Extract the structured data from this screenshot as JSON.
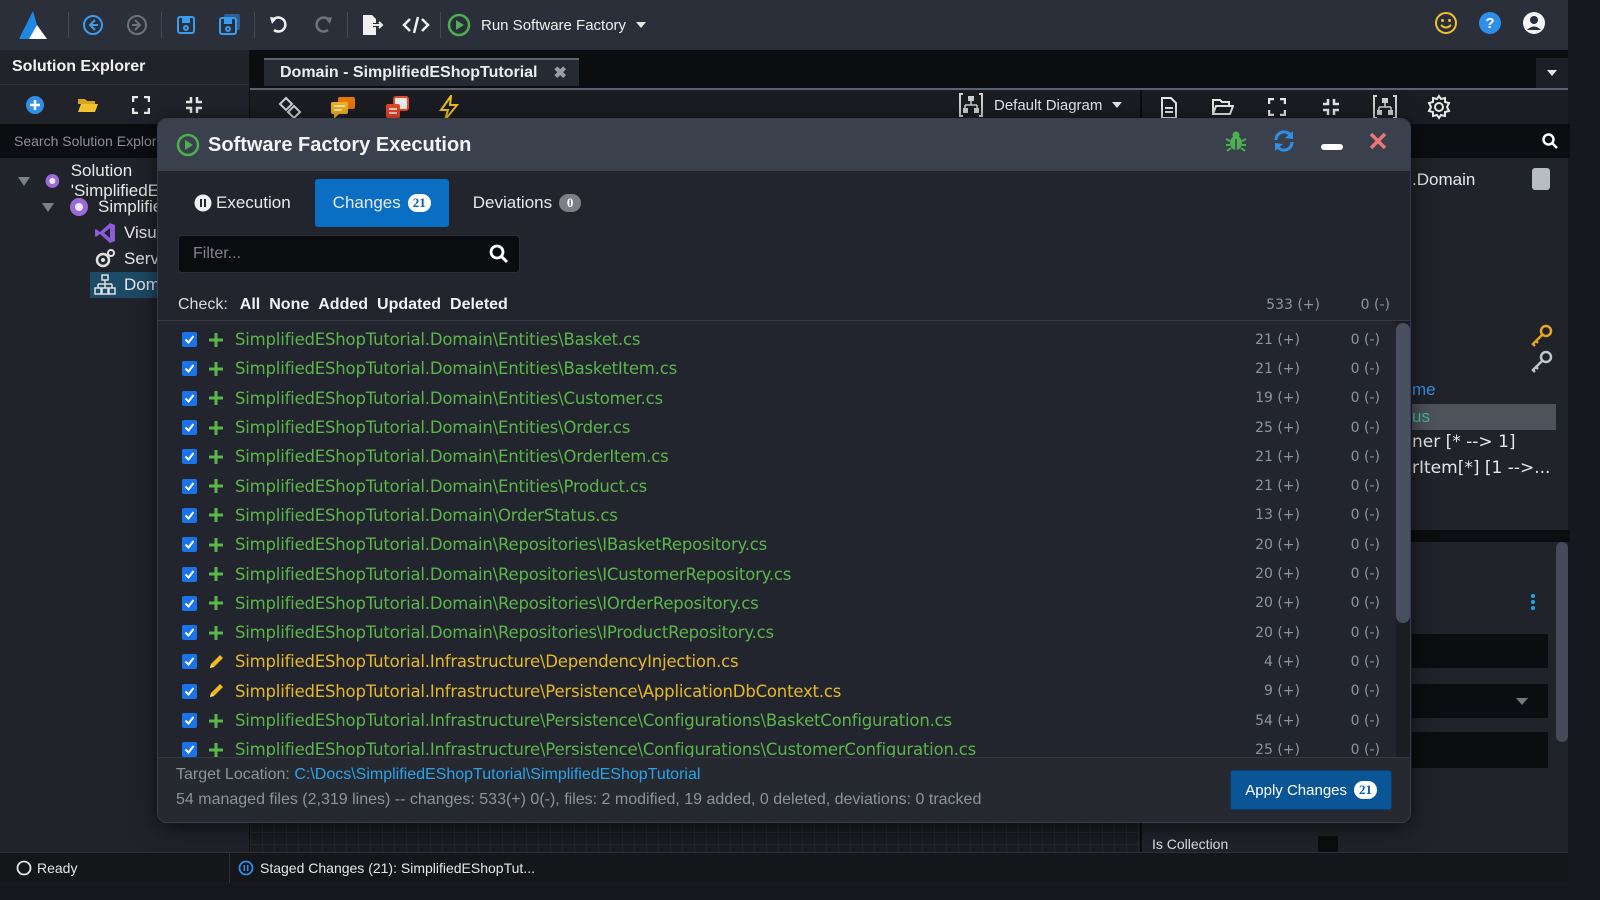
{
  "toolbar": {
    "run_label": "Run Software Factory",
    "icons": [
      "logo-icon",
      "back-icon",
      "forward-icon",
      "save-icon",
      "save-all-icon",
      "undo-icon",
      "redo-icon",
      "export-icon",
      "code-icon",
      "run-icon"
    ],
    "right_icons": [
      "feedback-smiley-icon",
      "help-icon",
      "account-icon"
    ]
  },
  "solution_explorer": {
    "title": "Solution Explorer",
    "search_placeholder": "Search Solution Explorer",
    "tree": [
      {
        "label": "Solution 'SimplifiedEShopTutorial'",
        "icon": "solution-icon"
      },
      {
        "label": "SimplifiedEShopTutorial",
        "icon": "application-icon"
      },
      {
        "label": "Visual Studio",
        "icon": "visual-studio-icon"
      },
      {
        "label": "Services",
        "icon": "services-icon"
      },
      {
        "label": "Domain",
        "icon": "domain-icon"
      }
    ]
  },
  "editor": {
    "tab_title": "Domain - SimplifiedEShopTutorial",
    "diagram_selector": "Default Diagram"
  },
  "right_panel": {
    "header": ".Domain",
    "items": [
      "me",
      "us",
      "ner [* --> 1]",
      "rItem[*] [1 -->..."
    ],
    "property_label": "Is Collection"
  },
  "modal": {
    "title": "Software Factory Execution",
    "tabs": [
      {
        "label": "Execution",
        "badge": null
      },
      {
        "label": "Changes",
        "badge": "21"
      },
      {
        "label": "Deviations",
        "badge": "0"
      }
    ],
    "filter_placeholder": "Filter...",
    "check": {
      "label": "Check:",
      "options": [
        "All",
        "None",
        "Added",
        "Updated",
        "Deleted"
      ],
      "total_added": "533 (+)",
      "total_deleted": "0 (-)"
    },
    "files": [
      {
        "path": "SimplifiedEShopTutorial.Domain\\Entities\\Basket.cs",
        "status": "added",
        "added": "21 (+)",
        "deleted": "0 (-)",
        "checked": true
      },
      {
        "path": "SimplifiedEShopTutorial.Domain\\Entities\\BasketItem.cs",
        "status": "added",
        "added": "21 (+)",
        "deleted": "0 (-)",
        "checked": true
      },
      {
        "path": "SimplifiedEShopTutorial.Domain\\Entities\\Customer.cs",
        "status": "added",
        "added": "19 (+)",
        "deleted": "0 (-)",
        "checked": true
      },
      {
        "path": "SimplifiedEShopTutorial.Domain\\Entities\\Order.cs",
        "status": "added",
        "added": "25 (+)",
        "deleted": "0 (-)",
        "checked": true
      },
      {
        "path": "SimplifiedEShopTutorial.Domain\\Entities\\OrderItem.cs",
        "status": "added",
        "added": "21 (+)",
        "deleted": "0 (-)",
        "checked": true
      },
      {
        "path": "SimplifiedEShopTutorial.Domain\\Entities\\Product.cs",
        "status": "added",
        "added": "21 (+)",
        "deleted": "0 (-)",
        "checked": true
      },
      {
        "path": "SimplifiedEShopTutorial.Domain\\OrderStatus.cs",
        "status": "added",
        "added": "13 (+)",
        "deleted": "0 (-)",
        "checked": true
      },
      {
        "path": "SimplifiedEShopTutorial.Domain\\Repositories\\IBasketRepository.cs",
        "status": "added",
        "added": "20 (+)",
        "deleted": "0 (-)",
        "checked": true
      },
      {
        "path": "SimplifiedEShopTutorial.Domain\\Repositories\\ICustomerRepository.cs",
        "status": "added",
        "added": "20 (+)",
        "deleted": "0 (-)",
        "checked": true
      },
      {
        "path": "SimplifiedEShopTutorial.Domain\\Repositories\\IOrderRepository.cs",
        "status": "added",
        "added": "20 (+)",
        "deleted": "0 (-)",
        "checked": true
      },
      {
        "path": "SimplifiedEShopTutorial.Domain\\Repositories\\IProductRepository.cs",
        "status": "added",
        "added": "20 (+)",
        "deleted": "0 (-)",
        "checked": true
      },
      {
        "path": "SimplifiedEShopTutorial.Infrastructure\\DependencyInjection.cs",
        "status": "modified",
        "added": "4 (+)",
        "deleted": "0 (-)",
        "checked": true
      },
      {
        "path": "SimplifiedEShopTutorial.Infrastructure\\Persistence\\ApplicationDbContext.cs",
        "status": "modified",
        "added": "9 (+)",
        "deleted": "0 (-)",
        "checked": true
      },
      {
        "path": "SimplifiedEShopTutorial.Infrastructure\\Persistence\\Configurations\\BasketConfiguration.cs",
        "status": "added",
        "added": "54 (+)",
        "deleted": "0 (-)",
        "checked": true
      },
      {
        "path": "SimplifiedEShopTutorial.Infrastructure\\Persistence\\Configurations\\CustomerConfiguration.cs",
        "status": "added",
        "added": "25 (+)",
        "deleted": "0 (-)",
        "checked": true
      }
    ],
    "footer": {
      "target_label": "Target Location:",
      "target_path": "C:\\Docs\\SimplifiedEShopTutorial\\SimplifiedEShopTutorial",
      "summary": "54 managed files (2,319 lines) -- changes: 533(+) 0(-), files: 2 modified, 19 added, 0 deleted, deviations: 0 tracked",
      "apply_label": "Apply Changes",
      "apply_badge": "21"
    }
  },
  "statusbar": {
    "ready": "Ready",
    "staged": "Staged Changes (21): SimplifiedEShopTut..."
  },
  "colors": {
    "accent": "#0a6fc2",
    "added": "#5bb54a",
    "modified": "#e5b82a",
    "link": "#2aa3e8"
  }
}
